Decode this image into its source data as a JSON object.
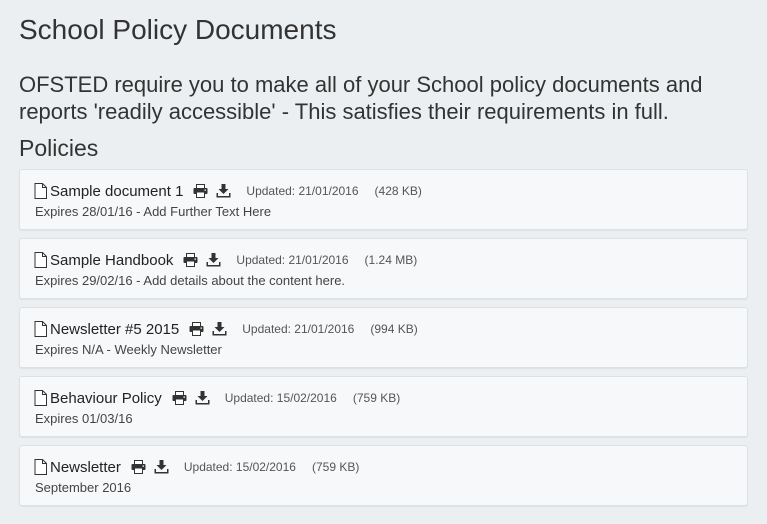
{
  "page": {
    "title": "School Policy Documents",
    "intro": "OFSTED require you to make all of your School policy documents and reports 'readily accessible' - This satisfies their requirements in full.",
    "section_title": "Policies"
  },
  "documents": [
    {
      "title": "Sample document 1",
      "updated": "Updated: 21/01/2016",
      "size": "(428 KB)",
      "description": "Expires 28/01/16 - Add Further Text Here"
    },
    {
      "title": "Sample Handbook",
      "updated": "Updated: 21/01/2016",
      "size": "(1.24 MB)",
      "description": "Expires 29/02/16 - Add details about the content here."
    },
    {
      "title": "Newsletter #5 2015",
      "updated": "Updated: 21/01/2016",
      "size": "(994 KB)",
      "description": "Expires N/A - Weekly Newsletter"
    },
    {
      "title": "Behaviour Policy",
      "updated": "Updated: 15/02/2016",
      "size": "(759 KB)",
      "description": "Expires 01/03/16"
    },
    {
      "title": "Newsletter",
      "updated": "Updated: 15/02/2016",
      "size": "(759 KB)",
      "description": "September 2016"
    }
  ],
  "icons": {
    "file": "file-icon",
    "print": "print-icon",
    "download": "download-icon"
  }
}
